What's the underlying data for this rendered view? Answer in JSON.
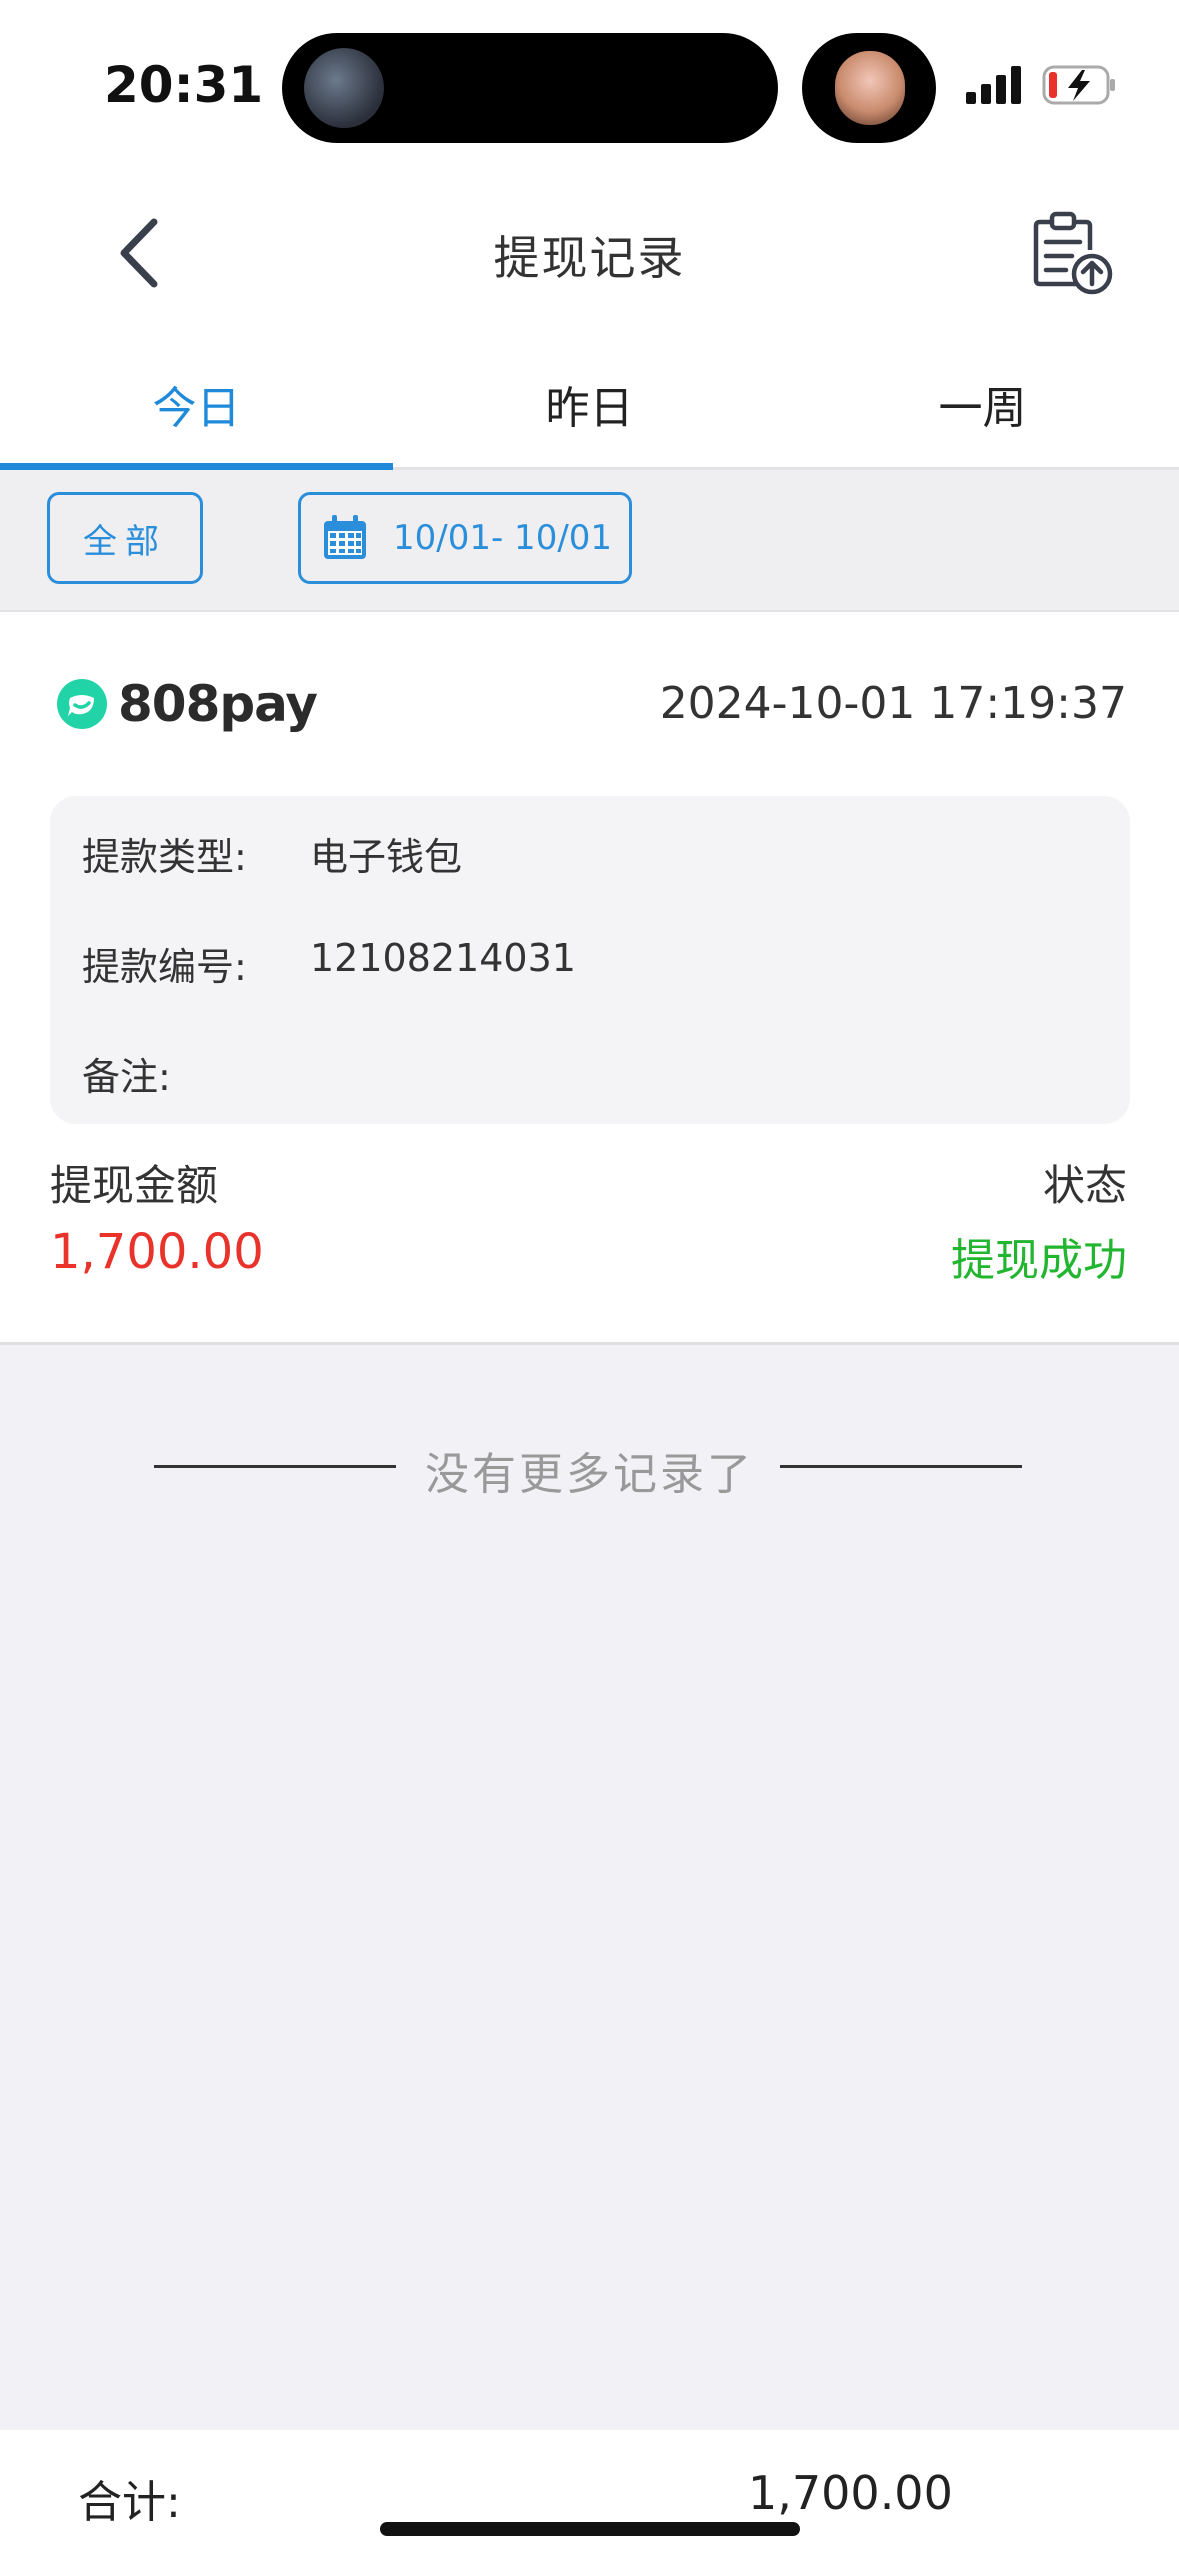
{
  "status_bar": {
    "time": "20:31"
  },
  "header": {
    "title": "提现记录",
    "back_icon": "chevron-left-icon",
    "export_icon": "clipboard-upload-icon"
  },
  "tabs": [
    {
      "label": "今日",
      "active": true
    },
    {
      "label": "昨日",
      "active": false
    },
    {
      "label": "一周",
      "active": false
    }
  ],
  "filters": {
    "all_label": "全部",
    "date_range": "10/01- 10/01",
    "calendar_icon": "calendar-icon"
  },
  "record": {
    "brand": "808pay",
    "datetime": "2024-10-01 17:19:37",
    "details": [
      {
        "key": "提款类型:",
        "value": "电子钱包"
      },
      {
        "key": "提款编号:",
        "value": "12108214031"
      },
      {
        "key": "备注:",
        "value": ""
      }
    ],
    "amount_label": "提现金额",
    "amount": "1,700.00",
    "status_label": "状态",
    "status": "提现成功"
  },
  "list_end_text": "没有更多记录了",
  "footer": {
    "total_label": "合计:",
    "total_value": "1,700.00"
  },
  "colors": {
    "accent": "#1e8ad9",
    "amount": "#e8322a",
    "success": "#22b52f",
    "brand_logo": "#22d3a8"
  }
}
